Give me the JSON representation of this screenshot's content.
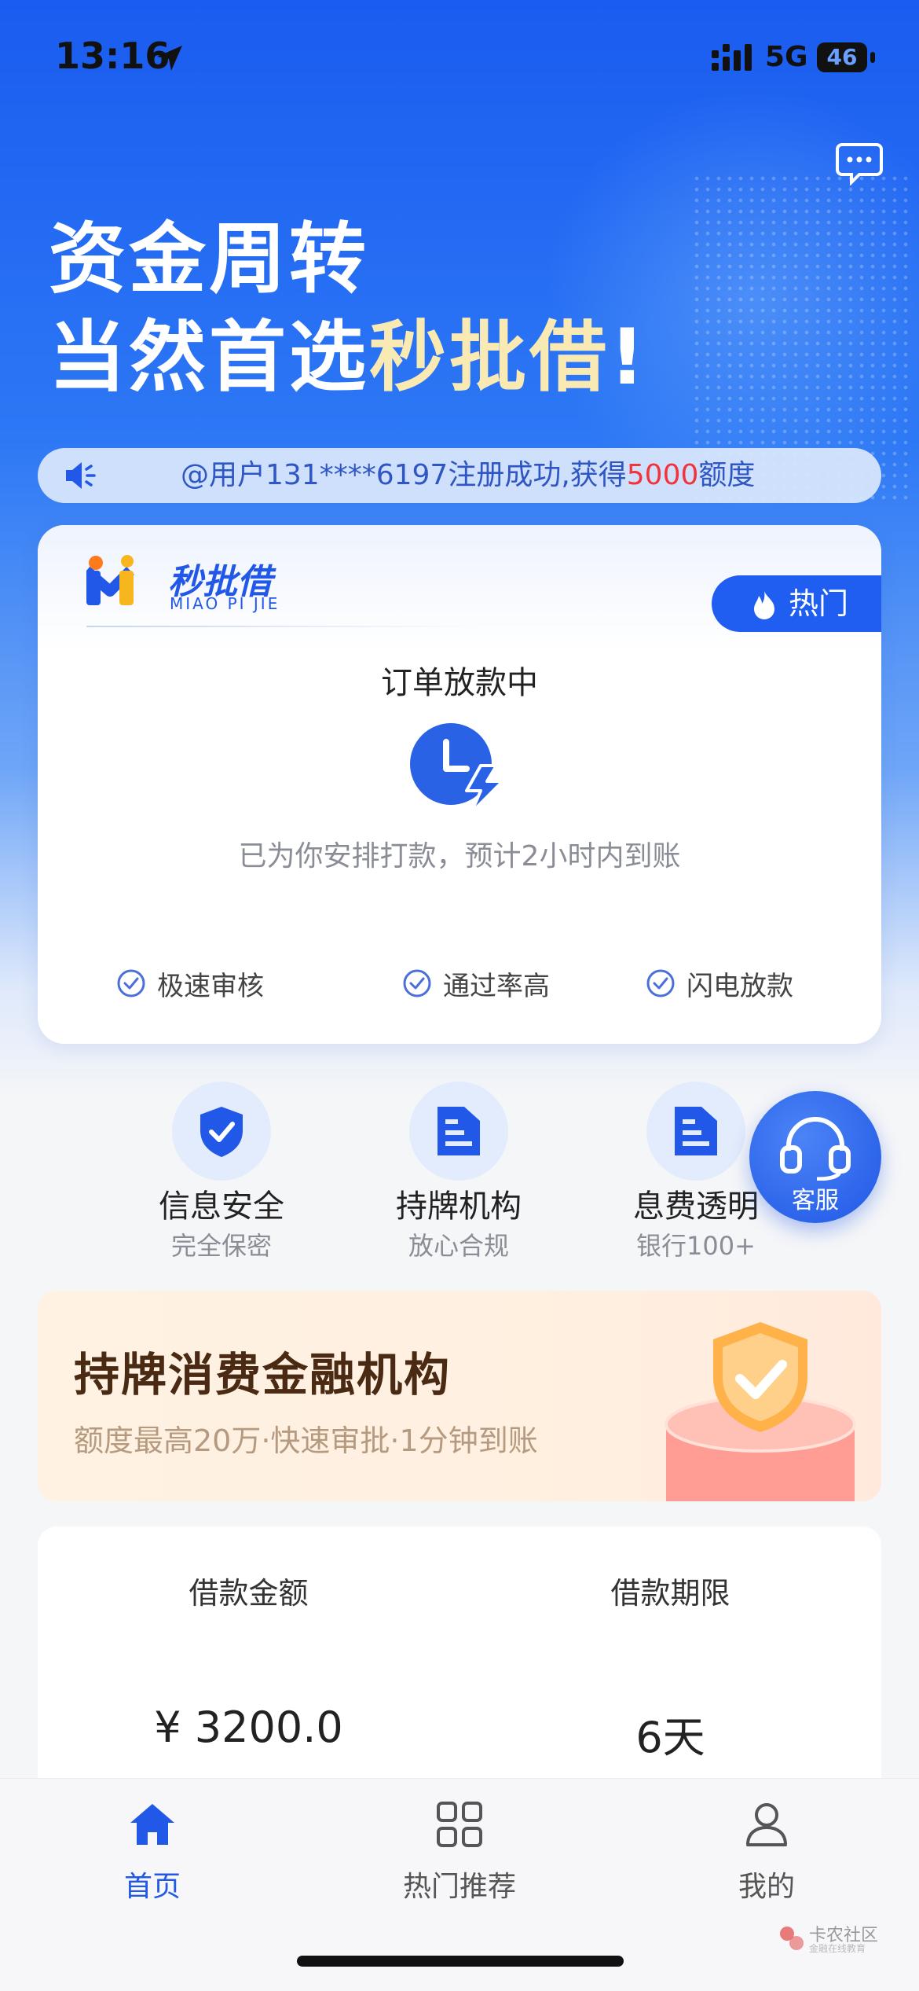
{
  "status_bar": {
    "time": "13:16",
    "network": "5G",
    "battery": "46"
  },
  "hero": {
    "headline_line1": "资金周转",
    "headline_line2_prefix": "当然首选",
    "headline_line2_accent": "秒批借",
    "headline_line2_suffix": "!"
  },
  "notice": {
    "text_prefix": "@用户131****6197注册成功,获得",
    "amount": "5000",
    "text_suffix": "额度"
  },
  "card": {
    "logo_cn": "秒批借",
    "logo_en": "MIAO PI JIE",
    "hot_tag": "热门",
    "order_title": "订单放款中",
    "order_desc": "已为你安排打款，预计2小时内到账",
    "features": [
      "极速审核",
      "通过率高",
      "闪电放款"
    ]
  },
  "trust": [
    {
      "title": "信息安全",
      "subtitle": "完全保密",
      "icon": "shield-check-icon"
    },
    {
      "title": "持牌机构",
      "subtitle": "放心合规",
      "icon": "document-icon"
    },
    {
      "title": "息费透明",
      "subtitle": "银行100+",
      "icon": "document-icon"
    }
  ],
  "fab": {
    "label": "客服"
  },
  "banner": {
    "title": "持牌消费金融机构",
    "subtitle": "额度最高20万·快速审批·1分钟到账"
  },
  "loan": {
    "amount_label": "借款金额",
    "amount_value": "¥ 3200.0",
    "term_label": "借款期限",
    "term_value": "6天"
  },
  "tabbar": [
    {
      "label": "首页",
      "icon": "home-icon",
      "active": true
    },
    {
      "label": "热门推荐",
      "icon": "grid-icon",
      "active": false
    },
    {
      "label": "我的",
      "icon": "user-icon",
      "active": false
    }
  ],
  "watermark": {
    "line1": "卡农社区",
    "line2": "金融在线教育"
  },
  "colors": {
    "brand_blue": "#2158e8",
    "accent_red": "#f2333b",
    "headline_accent": "#f9e9b3"
  }
}
